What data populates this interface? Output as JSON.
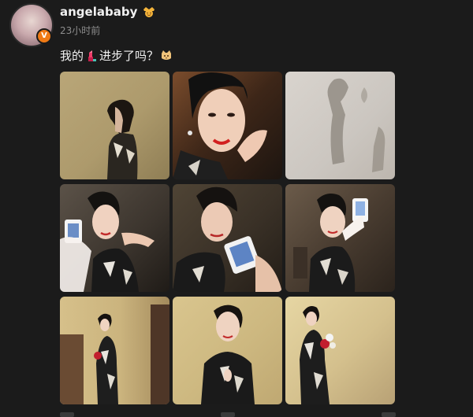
{
  "post": {
    "username": "angelababy",
    "timestamp": "23小时前",
    "text_before": "我的",
    "text_after": "进步了吗？",
    "verified_badge": "V"
  },
  "icons": {
    "verified": "verified-v-icon",
    "member_badge": "smiling-crown-face-icon",
    "emoji_1": "lipstick-emoji",
    "emoji_2": "cat-face-emoji"
  },
  "photos": [
    {
      "name": "photo-1",
      "subject": "side-profile-qipao"
    },
    {
      "name": "photo-2",
      "subject": "closeup-hand-on-cheek"
    },
    {
      "name": "photo-3",
      "subject": "shadow-on-wall"
    },
    {
      "name": "photo-4",
      "subject": "selfie-ring-light"
    },
    {
      "name": "photo-5",
      "subject": "selfie-ring-light-closeup"
    },
    {
      "name": "photo-6",
      "subject": "selfie-ring-light-seated"
    },
    {
      "name": "photo-7",
      "subject": "full-length-standing"
    },
    {
      "name": "photo-8",
      "subject": "half-length-front"
    },
    {
      "name": "photo-9",
      "subject": "full-length-flowers"
    }
  ]
}
